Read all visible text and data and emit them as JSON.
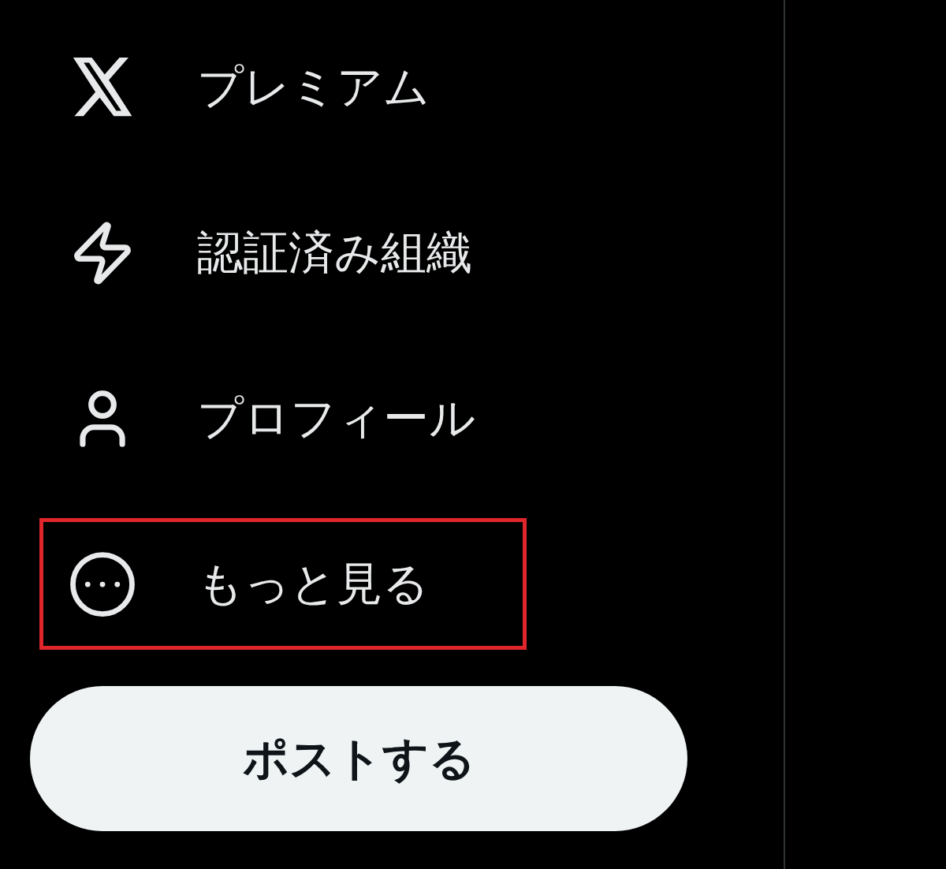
{
  "nav_items": [
    {
      "kind": "x-logo",
      "label": "プレミアム",
      "highlighted": false
    },
    {
      "kind": "bolt",
      "label": "認証済み組織",
      "highlighted": false
    },
    {
      "kind": "person",
      "label": "プロフィール",
      "highlighted": false
    },
    {
      "kind": "more",
      "label": "もっと見る",
      "highlighted": true
    }
  ],
  "post_button": "ポストする"
}
